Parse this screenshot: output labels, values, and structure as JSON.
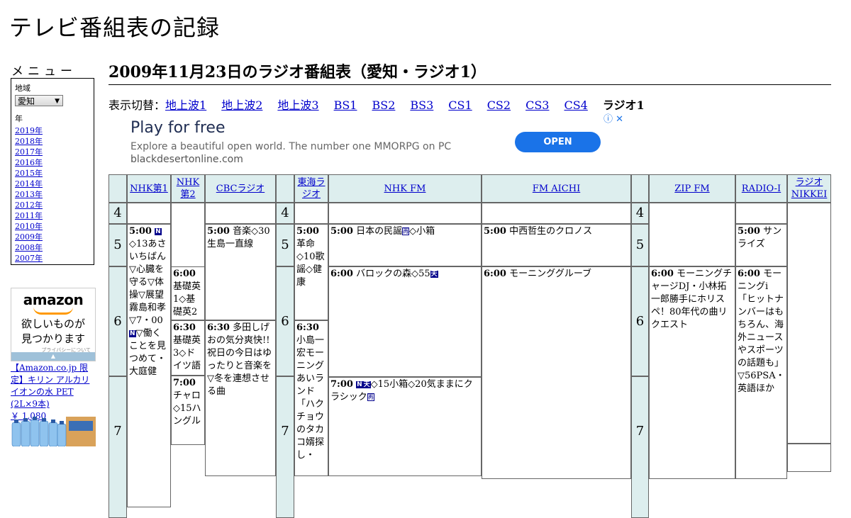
{
  "site": {
    "title": "テレビ番組表の記録"
  },
  "menu": {
    "heading": "メニュー",
    "region_label": "地域",
    "region_value": "愛知",
    "year_label": "年",
    "years": [
      "2019年",
      "2018年",
      "2017年",
      "2016年",
      "2015年",
      "2014年",
      "2013年",
      "2012年",
      "2011年",
      "2010年",
      "2009年",
      "2008年",
      "2007年"
    ]
  },
  "amazon": {
    "logo": "amazon",
    "copy_line1": "欲しいものが",
    "copy_line2": "見つかります",
    "privacy": "プライバシーについて",
    "promo_text": "【Amazon.co.jp 限定】キリン アルカリイオンの水 PET (2L×9本)",
    "price": "￥ 1,080"
  },
  "page": {
    "title": "2009年11月23日のラジオ番組表（愛知・ラジオ1）"
  },
  "switcher": {
    "label": "表示切替：",
    "links": [
      "地上波1",
      "地上波2",
      "地上波3",
      "BS1",
      "BS2",
      "BS3",
      "CS1",
      "CS2",
      "CS3",
      "CS4"
    ],
    "current": "ラジオ1"
  },
  "ad": {
    "headline": "Play for free",
    "description": "Explore a beautiful open world. The number one MMORPG on PC",
    "domain": "blackdesertonline.com",
    "cta": "OPEN"
  },
  "stations": [
    "NHK第1",
    "NHK第2",
    "CBCラジオ",
    "東海ラジオ",
    "NHK FM",
    "FM AICHI",
    "ZIP FM",
    "RADIO-I",
    "ラジオNIKKEI"
  ],
  "hours": [
    "4",
    "5",
    "6",
    "7"
  ],
  "programs": {
    "nhk1_500_time": "5:00",
    "nhk1_500_text": "◇13あさいちばん▽心臓を守る▽体操▽展望　霧島和孝▽7・00",
    "nhk1_500_text2": "▽働くことを見つめて・大庭健",
    "nhk2_600_time": "6:00",
    "nhk2_600_text": "基礎英1◇基礎英2",
    "nhk2_630_time": "6:30",
    "nhk2_630_text": "基礎英3◇ドイツ語",
    "nhk2_700_time": "7:00",
    "nhk2_700_text": "チャロ◇15ハングル",
    "cbc_500_time": "5:00",
    "cbc_500_text": "音楽◇30生島一直線",
    "cbc_630_time": "6:30",
    "cbc_630_text": "多田しげおの気分爽快!! 祝日の今日はゆったりと音楽を▽冬を連想させる曲",
    "tokai_500_time": "5:00",
    "tokai_500_text": "革命◇10歌謡◇健康",
    "tokai_630_time": "6:30",
    "tokai_630_text": "小島一宏モーニングあいランド「ハクチョウのタカコ婿探し・",
    "nhkfm_500_time": "5:00",
    "nhkfm_500_text": "日本の民謡",
    "nhkfm_500_text2": "◇小箱",
    "nhkfm_600_time": "6:00",
    "nhkfm_600_text": "バロックの森◇55",
    "nhkfm_700_time": "7:00",
    "nhkfm_700_text": "◇15小箱◇20気ままにクラシック",
    "fmaichi_500_time": "5:00",
    "fmaichi_500_text": "中西哲生のクロノス",
    "fmaichi_600_time": "6:00",
    "fmaichi_600_text": "モーニンググルーブ",
    "zip_600_time": "6:00",
    "zip_600_text": "モーニングチャージDJ・小林拓一郎勝手にホリスペ！80年代の曲リクエスト",
    "radioi_500_time": "5:00",
    "radioi_500_text": "サンライズ",
    "radioi_600_time": "6:00",
    "radioi_600_text": "モーニングi「ヒットナンバーはもちろん、海外ニュースやスポーツの話題も」▽56PSA・英語ほか",
    "badge_n": "N",
    "badge_ten": "天",
    "badge_sai": "再"
  }
}
